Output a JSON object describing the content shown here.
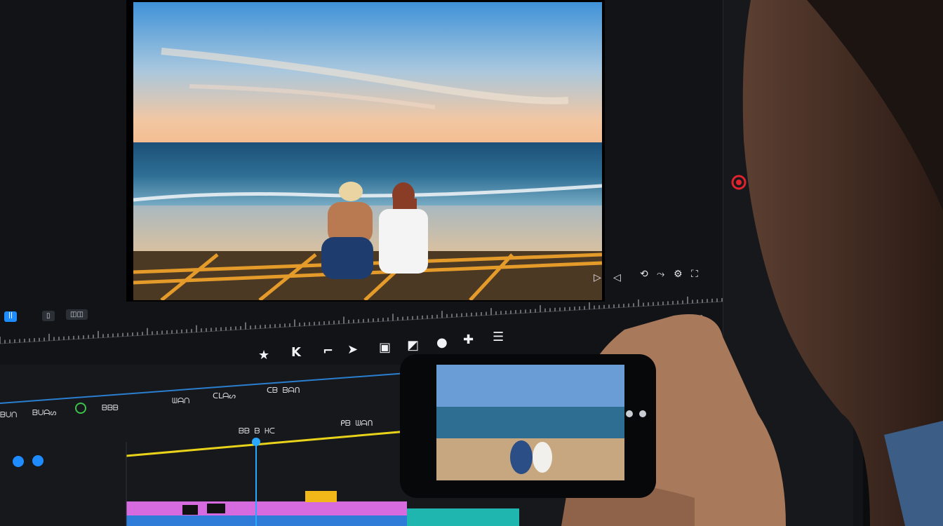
{
  "left_buttons": {
    "btn1": "ꟾꟾ",
    "btn2": "▯",
    "btn3": "◫◫"
  },
  "toolbar_icons": [
    "star-icon",
    "k-icon",
    "bracket-icon",
    "arrow-icon",
    "screen-icon",
    "image-icon",
    "circle-icon",
    "plus-icon",
    "list-icon"
  ],
  "timeline_labels": [
    "ᗷᑌᑎ",
    "ᗷᑌᗩᔕ",
    "ᗷᗷᗷ",
    "ᗯᗩᑎ",
    "ᑕᒪᗩᔕ",
    "ᑕᗷ ᗷᗩᑎ",
    "ᗷᗷ ᗷ ᕼᑕ",
    "ᑭᗷ ᗯᗩᑎ"
  ],
  "colors": {
    "accent": "#1e8bff",
    "playhead": "#2aa7ff",
    "track_yellow": "#e8d21a",
    "track_pink": "#d66be0",
    "track_blue": "#2f7bd8",
    "track_teal": "#1fb6b0",
    "record": "#e0232d"
  }
}
